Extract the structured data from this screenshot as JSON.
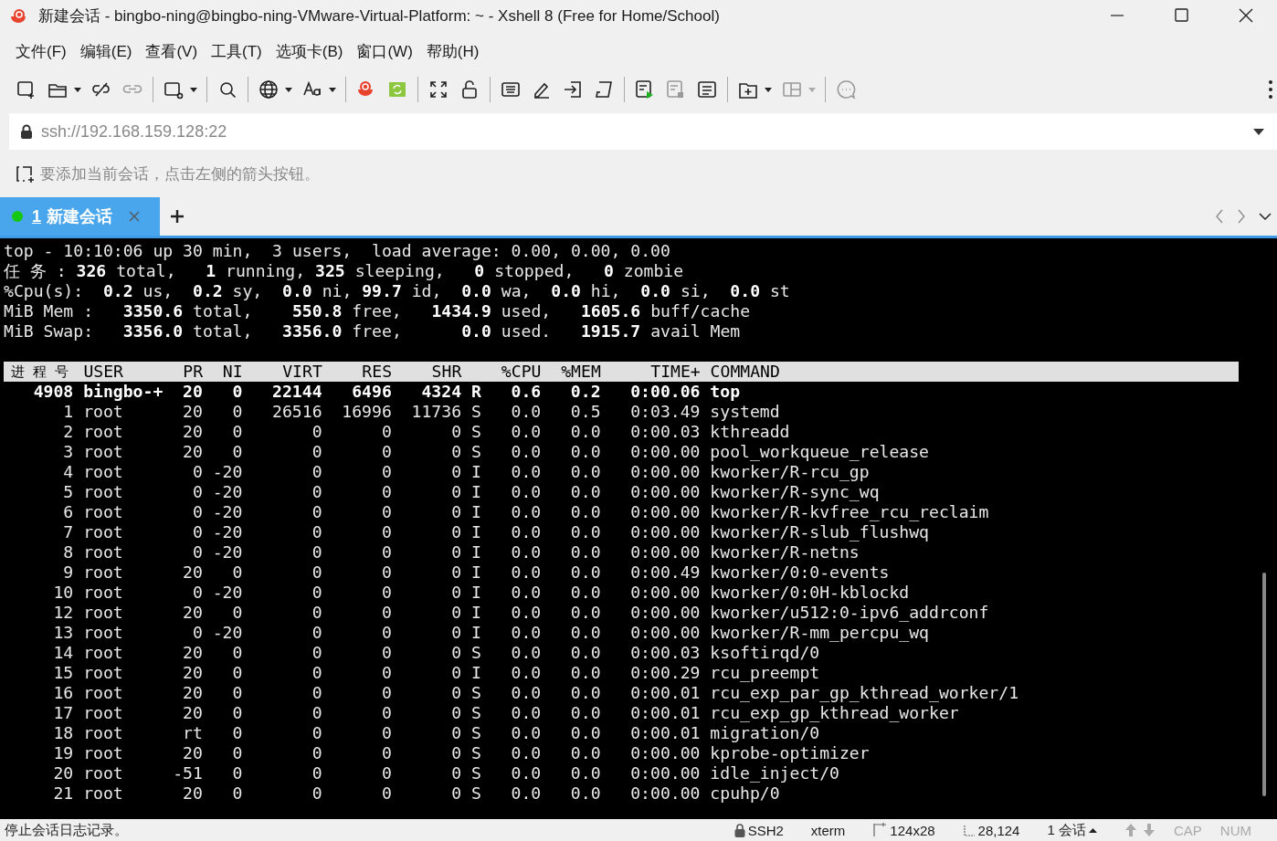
{
  "window": {
    "title": "新建会话 - bingbo-ning@bingbo-ning-VMware-Virtual-Platform: ~ - Xshell 8 (Free for Home/School)"
  },
  "menu": [
    "文件(F)",
    "编辑(E)",
    "查看(V)",
    "工具(T)",
    "选项卡(B)",
    "窗口(W)",
    "帮助(H)"
  ],
  "address": {
    "value": "ssh://192.168.159.128:22"
  },
  "hint": "要添加当前会话，点击左侧的箭头按钮。",
  "tabs": [
    {
      "number": "1",
      "label": "新建会话",
      "selected": true,
      "connected": true
    }
  ],
  "terminal": {
    "summary": [
      "top - 10:10:06 up 30 min,  3 users,  load average: 0.00, 0.00, 0.00",
      "任 务 : **326** total,   **1** running, **325** sleeping,   **0** stopped,   **0** zombie",
      "%Cpu(s):  **0.2** us,  **0.2** sy,  **0.0** ni, **99.7** id,  **0.0** wa,  **0.0** hi,  **0.0** si,  **0.0** st",
      "MiB Mem :   **3350.6** total,    **550.8** free,   **1434.9** used,   **1605.6** buff/cache",
      "MiB Swap:   **3356.0** total,   **3356.0** free,      **0.0** used.   **1915.7** avail Mem"
    ],
    "columns": [
      "进 程 号",
      "USER",
      "PR",
      "NI",
      "VIRT",
      "RES",
      "SHR",
      "",
      "%CPU",
      "%MEM",
      "TIME+",
      "COMMAND"
    ],
    "rows": [
      {
        "highlighted": true,
        "cells": [
          "4908",
          "bingbo-+",
          "20",
          "0",
          "22144",
          "6496",
          "4324",
          "R",
          "0.6",
          "0.2",
          "0:00.06",
          "top"
        ]
      },
      {
        "highlighted": false,
        "cells": [
          "1",
          "root",
          "20",
          "0",
          "26516",
          "16996",
          "11736",
          "S",
          "0.0",
          "0.5",
          "0:03.49",
          "systemd"
        ]
      },
      {
        "highlighted": false,
        "cells": [
          "2",
          "root",
          "20",
          "0",
          "0",
          "0",
          "0",
          "S",
          "0.0",
          "0.0",
          "0:00.03",
          "kthreadd"
        ]
      },
      {
        "highlighted": false,
        "cells": [
          "3",
          "root",
          "20",
          "0",
          "0",
          "0",
          "0",
          "S",
          "0.0",
          "0.0",
          "0:00.00",
          "pool_workqueue_release"
        ]
      },
      {
        "highlighted": false,
        "cells": [
          "4",
          "root",
          "0",
          "-20",
          "0",
          "0",
          "0",
          "I",
          "0.0",
          "0.0",
          "0:00.00",
          "kworker/R-rcu_gp"
        ]
      },
      {
        "highlighted": false,
        "cells": [
          "5",
          "root",
          "0",
          "-20",
          "0",
          "0",
          "0",
          "I",
          "0.0",
          "0.0",
          "0:00.00",
          "kworker/R-sync_wq"
        ]
      },
      {
        "highlighted": false,
        "cells": [
          "6",
          "root",
          "0",
          "-20",
          "0",
          "0",
          "0",
          "I",
          "0.0",
          "0.0",
          "0:00.00",
          "kworker/R-kvfree_rcu_reclaim"
        ]
      },
      {
        "highlighted": false,
        "cells": [
          "7",
          "root",
          "0",
          "-20",
          "0",
          "0",
          "0",
          "I",
          "0.0",
          "0.0",
          "0:00.00",
          "kworker/R-slub_flushwq"
        ]
      },
      {
        "highlighted": false,
        "cells": [
          "8",
          "root",
          "0",
          "-20",
          "0",
          "0",
          "0",
          "I",
          "0.0",
          "0.0",
          "0:00.00",
          "kworker/R-netns"
        ]
      },
      {
        "highlighted": false,
        "cells": [
          "9",
          "root",
          "20",
          "0",
          "0",
          "0",
          "0",
          "I",
          "0.0",
          "0.0",
          "0:00.49",
          "kworker/0:0-events"
        ]
      },
      {
        "highlighted": false,
        "cells": [
          "10",
          "root",
          "0",
          "-20",
          "0",
          "0",
          "0",
          "I",
          "0.0",
          "0.0",
          "0:00.00",
          "kworker/0:0H-kblockd"
        ]
      },
      {
        "highlighted": false,
        "cells": [
          "12",
          "root",
          "20",
          "0",
          "0",
          "0",
          "0",
          "I",
          "0.0",
          "0.0",
          "0:00.00",
          "kworker/u512:0-ipv6_addrconf"
        ]
      },
      {
        "highlighted": false,
        "cells": [
          "13",
          "root",
          "0",
          "-20",
          "0",
          "0",
          "0",
          "I",
          "0.0",
          "0.0",
          "0:00.00",
          "kworker/R-mm_percpu_wq"
        ]
      },
      {
        "highlighted": false,
        "cells": [
          "14",
          "root",
          "20",
          "0",
          "0",
          "0",
          "0",
          "S",
          "0.0",
          "0.0",
          "0:00.03",
          "ksoftirqd/0"
        ]
      },
      {
        "highlighted": false,
        "cells": [
          "15",
          "root",
          "20",
          "0",
          "0",
          "0",
          "0",
          "I",
          "0.0",
          "0.0",
          "0:00.29",
          "rcu_preempt"
        ]
      },
      {
        "highlighted": false,
        "cells": [
          "16",
          "root",
          "20",
          "0",
          "0",
          "0",
          "0",
          "S",
          "0.0",
          "0.0",
          "0:00.01",
          "rcu_exp_par_gp_kthread_worker/1"
        ]
      },
      {
        "highlighted": false,
        "cells": [
          "17",
          "root",
          "20",
          "0",
          "0",
          "0",
          "0",
          "S",
          "0.0",
          "0.0",
          "0:00.01",
          "rcu_exp_gp_kthread_worker"
        ]
      },
      {
        "highlighted": false,
        "cells": [
          "18",
          "root",
          "rt",
          "0",
          "0",
          "0",
          "0",
          "S",
          "0.0",
          "0.0",
          "0:00.01",
          "migration/0"
        ]
      },
      {
        "highlighted": false,
        "cells": [
          "19",
          "root",
          "20",
          "0",
          "0",
          "0",
          "0",
          "S",
          "0.0",
          "0.0",
          "0:00.00",
          "kprobe-optimizer"
        ]
      },
      {
        "highlighted": false,
        "cells": [
          "20",
          "root",
          "-51",
          "0",
          "0",
          "0",
          "0",
          "S",
          "0.0",
          "0.0",
          "0:00.00",
          "idle_inject/0"
        ]
      },
      {
        "highlighted": false,
        "cells": [
          "21",
          "root",
          "20",
          "0",
          "0",
          "0",
          "0",
          "S",
          "0.0",
          "0.0",
          "0:00.00",
          "cpuhp/0"
        ]
      }
    ]
  },
  "status_bar": {
    "message": "停止会话日志记录。",
    "items": [
      {
        "kind": "protocol",
        "text": "SSH2"
      },
      {
        "kind": "terminal",
        "text": "xterm"
      },
      {
        "kind": "size",
        "text": "124x28"
      },
      {
        "kind": "cursor",
        "text": "28,124"
      },
      {
        "kind": "sessions",
        "text": "1 会话"
      },
      {
        "kind": "arrows"
      },
      {
        "kind": "key",
        "text": "CAP",
        "on": false
      },
      {
        "kind": "key",
        "text": "NUM",
        "on": false
      }
    ]
  }
}
